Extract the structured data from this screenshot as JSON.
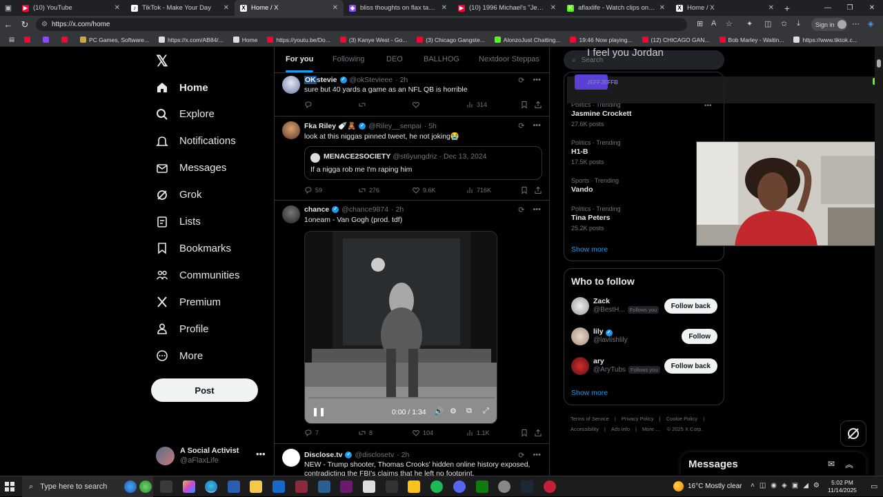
{
  "browser": {
    "tabs": [
      {
        "title": "(10) YouTube",
        "color": "#ff0033",
        "glyph": "▶"
      },
      {
        "title": "TikTok - Make Your Day",
        "color": "#000000",
        "glyph": "♪"
      },
      {
        "title": "Home / X",
        "color": "#000000",
        "glyph": "X",
        "active": true
      },
      {
        "title": "bliss thoughts on flax take - Twitc",
        "color": "#9146ff",
        "glyph": "◆"
      },
      {
        "title": "(10) 1996 Michael's \"Jew Me Sue",
        "color": "#ff0033",
        "glyph": "▶"
      },
      {
        "title": "aflaxlife - Watch clips on Kick",
        "color": "#53fc18",
        "glyph": "K"
      },
      {
        "title": "Home / X",
        "color": "#000000",
        "glyph": "X"
      }
    ],
    "url": "https://x.com/home",
    "signin_label": "Sign in",
    "bookmarks": [
      {
        "label": "",
        "color": "#ff0033"
      },
      {
        "label": "",
        "color": "#9146ff"
      },
      {
        "label": "",
        "color": "#ff0033"
      },
      {
        "label": "PC Games, Software...",
        "color": "#c9a74a"
      },
      {
        "label": "https://x.com/AB84/...",
        "color": "#000000"
      },
      {
        "label": "Home",
        "color": "#000000"
      },
      {
        "label": "https://youtu.be/Do...",
        "color": "#ff0033"
      },
      {
        "label": "(3) Kanye West - Go...",
        "color": "#ff0033"
      },
      {
        "label": "(3) Chicago Gangste...",
        "color": "#ff0033"
      },
      {
        "label": "AlonzoJust Chatting...",
        "color": "#53fc18"
      },
      {
        "label": "19:46 Now playing...",
        "color": "#ff0033"
      },
      {
        "label": "(12) CHICAGO GAN...",
        "color": "#ff0033"
      },
      {
        "label": "Bob Marley - Waitin...",
        "color": "#ff0033"
      },
      {
        "label": "https://www.tiktok.c...",
        "color": "#000000"
      }
    ]
  },
  "sidebar": {
    "items": [
      {
        "label": "Home",
        "icon": "home-icon"
      },
      {
        "label": "Explore",
        "icon": "search-icon"
      },
      {
        "label": "Notifications",
        "icon": "bell-icon"
      },
      {
        "label": "Messages",
        "icon": "envelope-icon"
      },
      {
        "label": "Grok",
        "icon": "grok-icon"
      },
      {
        "label": "Lists",
        "icon": "list-icon"
      },
      {
        "label": "Bookmarks",
        "icon": "bookmark-icon"
      },
      {
        "label": "Communities",
        "icon": "communities-icon"
      },
      {
        "label": "Premium",
        "icon": "x-premium-icon"
      },
      {
        "label": "Profile",
        "icon": "person-icon"
      },
      {
        "label": "More",
        "icon": "more-circle-icon"
      }
    ],
    "post_label": "Post",
    "account": {
      "name": "A Social Activist",
      "handle": "@aFlaxLife"
    }
  },
  "feed": {
    "tabs": [
      "For you",
      "Following",
      "DEO",
      "BALLHOG",
      "Nextdoor Steppas"
    ],
    "tweets": [
      {
        "name_prefix": "OK",
        "name": "stevie",
        "handle": "@okStevieee",
        "time": "· 2h",
        "text": "sure but 40 yards a game as an NFL QB is horrible",
        "replies": "",
        "retweets": "",
        "likes": "",
        "views": "314"
      },
      {
        "name": "Fka Riley 🍼🧸",
        "handle": "@Riley__senpai",
        "time": "· 5h",
        "text": "look at this niggas pinned tweet, he not joking😭",
        "quote": {
          "name": "MENACE2SOCIETY",
          "handle": "@st6yungdriz",
          "time": "· Dec 13, 2024",
          "text": "If a nigga rob me I'm raping him"
        },
        "replies": "59",
        "retweets": "276",
        "likes": "9.6K",
        "views": "716K"
      },
      {
        "name": "chance",
        "handle": "@chance9874",
        "time": "· 2h",
        "text": "1oneam - Van Gogh (prod. tdf)",
        "video_time": "0:00 / 1:34",
        "replies": "7",
        "retweets": "8",
        "likes": "104",
        "views": "1.1K"
      },
      {
        "name": "Disclose.tv",
        "handle": "@disclosetv",
        "time": "· 2h",
        "text": "NEW - Trump shooter, Thomas Crooks' hidden online history exposed,",
        "text2": "contradicting the FBI's claims that he left no footprint."
      }
    ]
  },
  "right": {
    "search_placeholder": "Search",
    "trends": [
      {
        "category": "Politics · Trending",
        "name": "Jasmine Crockett",
        "count": "27.6K posts"
      },
      {
        "category": "Politics · Trending",
        "name": "H1-B",
        "count": "17.5K posts"
      },
      {
        "category": "Sports · Trending",
        "name": "Vando",
        "count": ""
      },
      {
        "category": "Politics · Trending",
        "name": "Tina Peters",
        "count": "25.2K posts"
      }
    ],
    "trends_show_more": "Show more",
    "who_to_follow": {
      "title": "Who to follow",
      "users": [
        {
          "name": "Zack",
          "handle": "@BestH...",
          "follows_you": "Follows you",
          "button": "Follow back"
        },
        {
          "name": "lily",
          "handle": "@lavlishlily",
          "follows_you": "",
          "button": "Follow"
        },
        {
          "name": "ary",
          "handle": "@AryTubs",
          "follows_you": "Follows you",
          "button": "Follow back"
        }
      ],
      "show_more": "Show more"
    },
    "footer": [
      "Terms of Service",
      "Privacy Policy",
      "Cookie Policy",
      "Accessibility",
      "Ads info",
      "More ...",
      "© 2025 X Corp."
    ]
  },
  "overlay": {
    "caption": "I feel you Jordan",
    "badge": "JEFFJEFFB"
  },
  "messages_label": "Messages",
  "taskbar": {
    "search_placeholder": "Type here to search",
    "weather": "16°C  Mostly clear",
    "time": "5:02 PM",
    "date": "11/14/2025"
  }
}
